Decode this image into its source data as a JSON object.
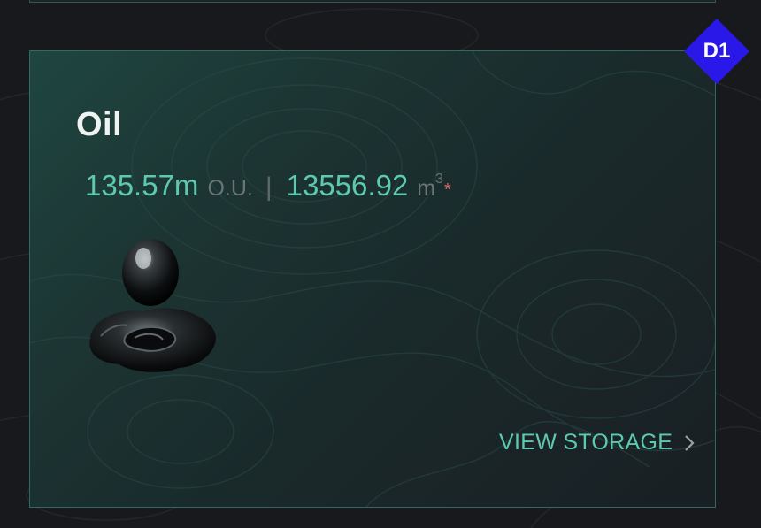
{
  "resource": {
    "name": "Oil",
    "amount_ou": "135.57m",
    "unit_ou": "O.U.",
    "separator": "|",
    "volume": "13556.92",
    "unit_volume": "m",
    "unit_volume_exp": "3",
    "note_marker": "*",
    "image_icon": "oil-drop-icon"
  },
  "actions": {
    "view_storage_label": "VIEW STORAGE",
    "view_storage_icon": "chevron-right-icon"
  },
  "badge": {
    "label": "D1",
    "color": "#2a18e8"
  },
  "colors": {
    "accent": "#5ec9b1",
    "card_border": "#2e6a61",
    "asterisk": "#e2676b",
    "background": "#17191d"
  }
}
